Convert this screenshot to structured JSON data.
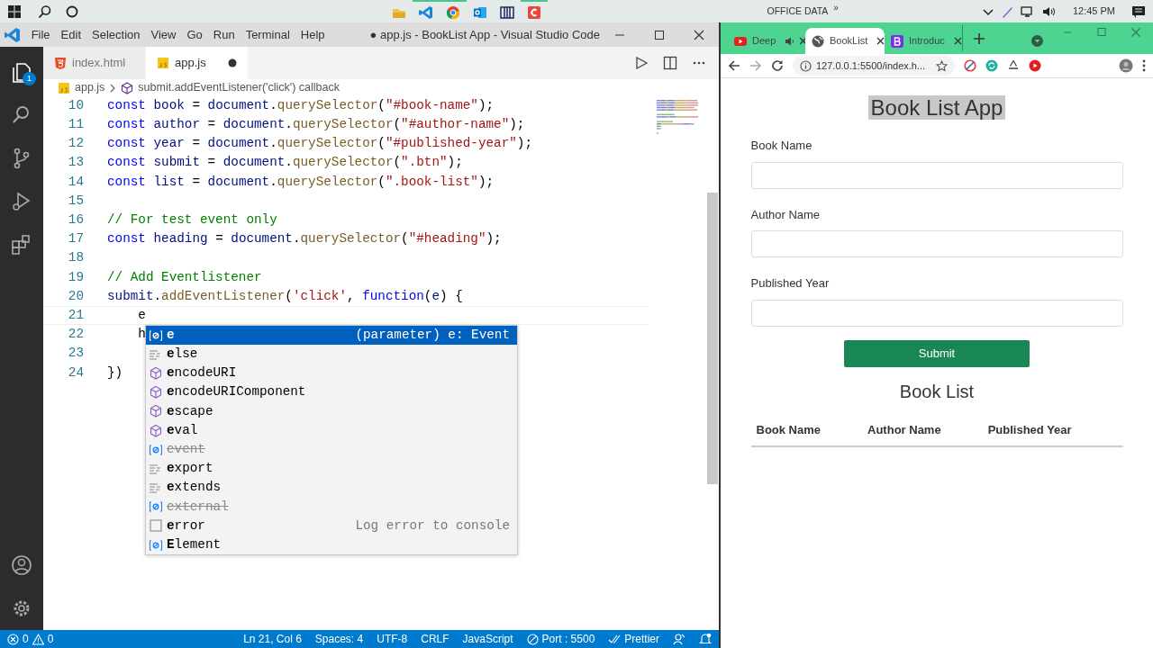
{
  "taskbar": {
    "apps": [
      {
        "kind": "folder",
        "running": false
      },
      {
        "kind": "vscode",
        "running": true
      },
      {
        "kind": "chrome",
        "running": true
      },
      {
        "kind": "outlook",
        "running": false
      },
      {
        "kind": "books",
        "running": false
      },
      {
        "kind": "red-app",
        "running": true
      }
    ],
    "toolbar_label": "OFFICE DATA",
    "toolbar_chevron": "»",
    "time": "12:45 PM"
  },
  "vscode": {
    "menu": [
      "File",
      "Edit",
      "Selection",
      "View",
      "Go",
      "Run",
      "Terminal",
      "Help"
    ],
    "title": "● app.js - BookList App - Visual Studio Code",
    "explorer_badge": "1",
    "tabs": [
      {
        "label": "index.html",
        "kind": "html",
        "selected": false,
        "dirty": false
      },
      {
        "label": "app.js",
        "kind": "js",
        "selected": true,
        "dirty": true
      }
    ],
    "breadcrumb": [
      {
        "label": "app.js",
        "kind": "js"
      },
      {
        "label": "submit.addEventListener('click') callback",
        "kind": "function"
      }
    ],
    "lines": [
      {
        "number": "10",
        "current": false,
        "tokens": [
          {
            "kind": "keyword",
            "text": "const"
          },
          {
            "kind": "variable",
            "text": " book"
          },
          {
            "kind": "plain",
            "text": " = "
          },
          {
            "kind": "variable",
            "text": "document"
          },
          {
            "kind": "plain",
            "text": "."
          },
          {
            "kind": "function",
            "text": "querySelector"
          },
          {
            "kind": "plain",
            "text": "("
          },
          {
            "kind": "string",
            "text": "\"#book-name\""
          },
          {
            "kind": "plain",
            "text": ");"
          }
        ]
      },
      {
        "number": "11",
        "current": false,
        "tokens": [
          {
            "kind": "keyword",
            "text": "const"
          },
          {
            "kind": "variable",
            "text": " author"
          },
          {
            "kind": "plain",
            "text": " = "
          },
          {
            "kind": "variable",
            "text": "document"
          },
          {
            "kind": "plain",
            "text": "."
          },
          {
            "kind": "function",
            "text": "querySelector"
          },
          {
            "kind": "plain",
            "text": "("
          },
          {
            "kind": "string",
            "text": "\"#author-name\""
          },
          {
            "kind": "plain",
            "text": ");"
          }
        ]
      },
      {
        "number": "12",
        "current": false,
        "tokens": [
          {
            "kind": "keyword",
            "text": "const"
          },
          {
            "kind": "variable",
            "text": " year"
          },
          {
            "kind": "plain",
            "text": " = "
          },
          {
            "kind": "variable",
            "text": "document"
          },
          {
            "kind": "plain",
            "text": "."
          },
          {
            "kind": "function",
            "text": "querySelector"
          },
          {
            "kind": "plain",
            "text": "("
          },
          {
            "kind": "string",
            "text": "\"#published-year\""
          },
          {
            "kind": "plain",
            "text": ");"
          }
        ]
      },
      {
        "number": "13",
        "current": false,
        "tokens": [
          {
            "kind": "keyword",
            "text": "const"
          },
          {
            "kind": "variable",
            "text": " submit"
          },
          {
            "kind": "plain",
            "text": " = "
          },
          {
            "kind": "variable",
            "text": "document"
          },
          {
            "kind": "plain",
            "text": "."
          },
          {
            "kind": "function",
            "text": "querySelector"
          },
          {
            "kind": "plain",
            "text": "("
          },
          {
            "kind": "string",
            "text": "\".btn\""
          },
          {
            "kind": "plain",
            "text": ");"
          }
        ]
      },
      {
        "number": "14",
        "current": false,
        "tokens": [
          {
            "kind": "keyword",
            "text": "const"
          },
          {
            "kind": "variable",
            "text": " list"
          },
          {
            "kind": "plain",
            "text": " = "
          },
          {
            "kind": "variable",
            "text": "document"
          },
          {
            "kind": "plain",
            "text": "."
          },
          {
            "kind": "function",
            "text": "querySelector"
          },
          {
            "kind": "plain",
            "text": "("
          },
          {
            "kind": "string",
            "text": "\".book-list\""
          },
          {
            "kind": "plain",
            "text": ");"
          }
        ]
      },
      {
        "number": "15",
        "current": false
      },
      {
        "number": "16",
        "current": false,
        "tokens": [
          {
            "kind": "comment",
            "text": "// For test event only"
          }
        ]
      },
      {
        "number": "17",
        "current": false,
        "tokens": [
          {
            "kind": "keyword",
            "text": "const"
          },
          {
            "kind": "variable",
            "text": " heading"
          },
          {
            "kind": "plain",
            "text": " = "
          },
          {
            "kind": "variable",
            "text": "document"
          },
          {
            "kind": "plain",
            "text": "."
          },
          {
            "kind": "function",
            "text": "querySelector"
          },
          {
            "kind": "plain",
            "text": "("
          },
          {
            "kind": "string",
            "text": "\"#heading\""
          },
          {
            "kind": "plain",
            "text": ");"
          }
        ]
      },
      {
        "number": "18",
        "current": false
      },
      {
        "number": "19",
        "current": false,
        "tokens": [
          {
            "kind": "comment",
            "text": "// Add Eventlistener"
          }
        ]
      },
      {
        "number": "20",
        "current": false,
        "tokens": [
          {
            "kind": "variable",
            "text": "submit"
          },
          {
            "kind": "plain",
            "text": "."
          },
          {
            "kind": "function",
            "text": "addEventListener"
          },
          {
            "kind": "plain",
            "text": "("
          },
          {
            "kind": "string",
            "text": "'click'"
          },
          {
            "kind": "plain",
            "text": ", "
          },
          {
            "kind": "keyword",
            "text": "function"
          },
          {
            "kind": "plain",
            "text": "("
          },
          {
            "kind": "variable",
            "text": "e"
          },
          {
            "kind": "plain",
            "text": ") {"
          }
        ]
      },
      {
        "number": "21",
        "current": true,
        "tokens": [
          {
            "kind": "plain",
            "text": "    e"
          }
        ]
      },
      {
        "number": "22",
        "current": false,
        "tokens": [
          {
            "kind": "plain",
            "text": "    h"
          }
        ]
      },
      {
        "number": "23",
        "current": false
      },
      {
        "number": "24",
        "current": false,
        "tokens": [
          {
            "kind": "plain",
            "text": "})"
          }
        ]
      }
    ],
    "suggest": {
      "items": [
        {
          "label": "**e**",
          "kind": "variable",
          "deprecated": false,
          "selected": true,
          "detail": "(parameter) e: Event"
        },
        {
          "label": "**e**lse",
          "kind": "keyword",
          "deprecated": false,
          "selected": false
        },
        {
          "label": "**e**ncodeURI",
          "kind": "method",
          "deprecated": false,
          "selected": false
        },
        {
          "label": "**e**ncodeURIComponent",
          "kind": "method",
          "deprecated": false,
          "selected": false
        },
        {
          "label": "**e**scape",
          "kind": "method",
          "deprecated": false,
          "selected": false
        },
        {
          "label": "**e**val",
          "kind": "method",
          "deprecated": false,
          "selected": false
        },
        {
          "label": "event",
          "kind": "variable",
          "deprecated": true,
          "selected": false
        },
        {
          "label": "**e**xport",
          "kind": "keyword",
          "deprecated": false,
          "selected": false
        },
        {
          "label": "**e**xtends",
          "kind": "keyword",
          "deprecated": false,
          "selected": false
        },
        {
          "label": "external",
          "kind": "variable",
          "deprecated": true,
          "selected": false
        },
        {
          "label": "**e**rror",
          "kind": "snippet",
          "deprecated": false,
          "selected": false,
          "detail": "Log error to console"
        },
        {
          "label": "**E**lement",
          "kind": "variable",
          "deprecated": false,
          "selected": false
        }
      ]
    },
    "status_bar": {
      "errors": "0",
      "warnings": "0",
      "items": [
        {
          "kind": "text",
          "label": "Ln 21, Col 6"
        },
        {
          "kind": "text",
          "label": "Spaces: 4"
        },
        {
          "kind": "text",
          "label": "UTF-8"
        },
        {
          "kind": "text",
          "label": "CRLF"
        },
        {
          "kind": "text",
          "label": "JavaScript"
        },
        {
          "kind": "port",
          "label": "Port : 5500"
        },
        {
          "kind": "prettier",
          "label": "Prettier"
        }
      ]
    }
  },
  "browser": {
    "tabs": [
      {
        "label": "Deep",
        "kind": "video",
        "audio": true,
        "selected": false
      },
      {
        "label": "BookList",
        "kind": "web",
        "audio": false,
        "selected": true
      },
      {
        "label": "Introduc",
        "kind": "docs",
        "audio": false,
        "selected": false
      }
    ],
    "url": "127.0.0.1:5500/index.h...",
    "page": {
      "heading": "Book List App",
      "heading_selected": true,
      "fields": [
        {
          "label": "Book Name"
        },
        {
          "label": "Author Name"
        },
        {
          "label": "Published Year"
        }
      ],
      "submit": "Submit",
      "list_title": "Book List",
      "columns": [
        "Book Name",
        "Author Name",
        "Published Year"
      ]
    }
  }
}
